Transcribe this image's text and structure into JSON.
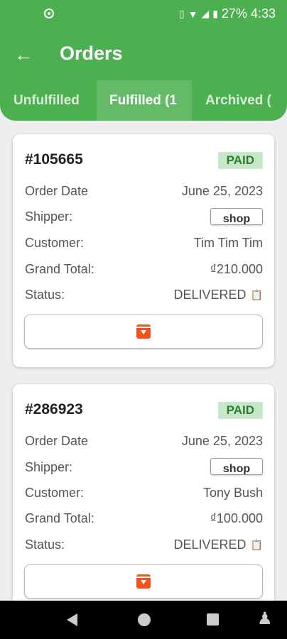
{
  "status_bar": {
    "battery": "27%",
    "time": "4:33",
    "icons": [
      "vibrate-icon",
      "wifi-icon",
      "signal-icon",
      "battery-icon"
    ]
  },
  "header": {
    "title": "Orders",
    "back_icon": "arrow-left-icon",
    "tabs": [
      {
        "label": "Unfulfilled",
        "selected": false
      },
      {
        "label": "Fulfilled (1",
        "selected": true
      },
      {
        "label": "Archived (",
        "selected": false
      }
    ]
  },
  "colors": {
    "primary": "#4caf50",
    "paid_bg": "#c8e6c9",
    "paid_text": "#2e7d32",
    "action_icon": "#f4511e"
  },
  "labels": {
    "order_date": "Order Date",
    "shipper": "Shipper:",
    "customer": "Customer:",
    "grand_total": "Grand Total:",
    "status": "Status:"
  },
  "orders": [
    {
      "id": "#105665",
      "payment": "PAID",
      "order_date": "June 25, 2023",
      "shipper": "shop",
      "customer": "Tim Tim Tim",
      "grand_total": "₫210.000",
      "status": "DELIVERED"
    },
    {
      "id": "#286923",
      "payment": "PAID",
      "order_date": "June 25, 2023",
      "shipper": "shop",
      "customer": "Tony Bush",
      "grand_total": "₫100.000",
      "status": "DELIVERED"
    }
  ]
}
